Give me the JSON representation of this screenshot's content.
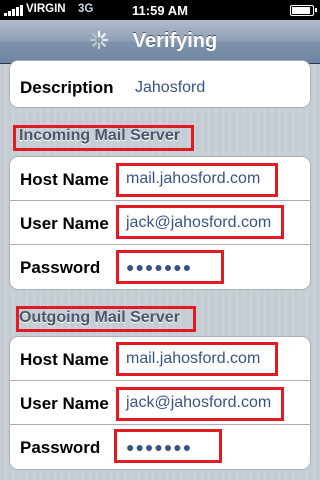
{
  "status_bar": {
    "carrier": "VIRGIN",
    "network": "3G",
    "time": "11:59 AM",
    "battery_level": 0.95
  },
  "nav": {
    "title": "Verifying"
  },
  "account": {
    "description_label": "Description",
    "description_value": "Jahosford"
  },
  "incoming": {
    "header": "Incoming Mail Server",
    "host_label": "Host Name",
    "host_value": "mail.jahosford.com",
    "user_label": "User Name",
    "user_value": "jack@jahosford.com",
    "password_label": "Password",
    "password_value": "●●●●●●●"
  },
  "outgoing": {
    "header": "Outgoing Mail Server",
    "host_label": "Host Name",
    "host_value": "mail.jahosford.com",
    "user_label": "User Name",
    "user_value": "jack@jahosford.com",
    "password_label": "Password",
    "password_value": "●●●●●●●"
  },
  "colors": {
    "highlight": "#e01b24",
    "value_text": "#385487",
    "nav_bar": "#6e84a2"
  }
}
